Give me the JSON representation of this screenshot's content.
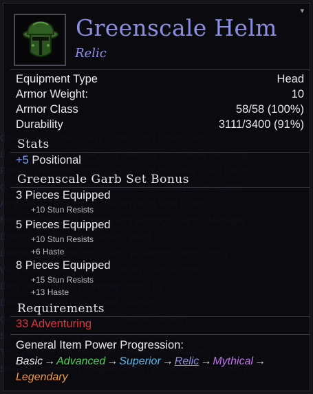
{
  "background_chat": [
    "[Chat - Say] [Chat - Say] [Chat - Say] [Chat - Say]",
    "[Lowtide] [Ramhorn Dagger] [Rat Gut Short Bow] [Fetching",
    "[Frenzy] [Hammer Torch] [Greaves of the Vale] [Flex] [Reco",
    "[Gravestone Shield] [Patchscale Tribal Staff] [Daisy Cutter",
    "[Amplified] [Thick Beast Bracer] [Wild Wolf Leath",
    "[Meteorite Hatchet] [Rolling Pin] [Midnight Band] [Midnight",
    "[Dominance] [Wolfbite Gloves] [Wild",
    "[Leather Cap] [Shining Faulds] [Freehold Patrol Torch]",
    "[Wild Moss Tunic] [Boots of Decay] [Ankle Protec",
    "[Dark Wolf Faulds] [Surestep Boots] [S",
    "[Deeproot Helm] [Salt Cured Leather",
    "[Gloomweave Robe] [Ooze Covered Gloves]",
    "[Spriggan Bracelet] [Netherbone Necklace",
    "[Troll Earring] [Necklace of Confinement] [Woven G",
    "[Sweet Fragrances] [Plague Wraps] [Toxxvale Short Bow] [Gr"
  ],
  "item": {
    "name": "Greenscale Helm",
    "rarity": "Relic",
    "icon": "green-helm-icon",
    "rarity_color": "#8c8ee2"
  },
  "properties": [
    {
      "label": "Equipment Type",
      "value": "Head"
    },
    {
      "label": "Armor Weight:",
      "value": "10"
    },
    {
      "label": "Armor Class",
      "value": "58/58 (100%)"
    },
    {
      "label": "Durability",
      "value": "3111/3400 (91%)"
    }
  ],
  "stats": {
    "heading": "Stats",
    "lines": [
      {
        "amount": "+5",
        "name": "Positional"
      }
    ]
  },
  "set_bonus": {
    "heading": "Greenscale Garb Set Bonus",
    "tiers": [
      {
        "label": "3 Pieces Equipped",
        "bonuses": [
          "+10 Stun Resists"
        ]
      },
      {
        "label": "5 Pieces Equipped",
        "bonuses": [
          "+10 Stun Resists",
          "+6 Haste"
        ]
      },
      {
        "label": "8 Pieces Equipped",
        "bonuses": [
          "+15 Stun Resists",
          "+13 Haste"
        ]
      }
    ]
  },
  "requirements": {
    "heading": "Requirements",
    "value": "33 Adventuring",
    "color": "#e3303a"
  },
  "progression": {
    "heading": "General Item Power Progression:",
    "tiers": [
      {
        "name": "Basic",
        "color": "#f0f0f0"
      },
      {
        "name": "Advanced",
        "color": "#4ed35a"
      },
      {
        "name": "Superior",
        "color": "#55b8f0"
      },
      {
        "name": "Relic",
        "color": "#8c8ee2"
      },
      {
        "name": "Mythical",
        "color": "#c070ee"
      },
      {
        "name": "Legendary",
        "color": "#f09a40"
      }
    ],
    "separator": "→"
  }
}
